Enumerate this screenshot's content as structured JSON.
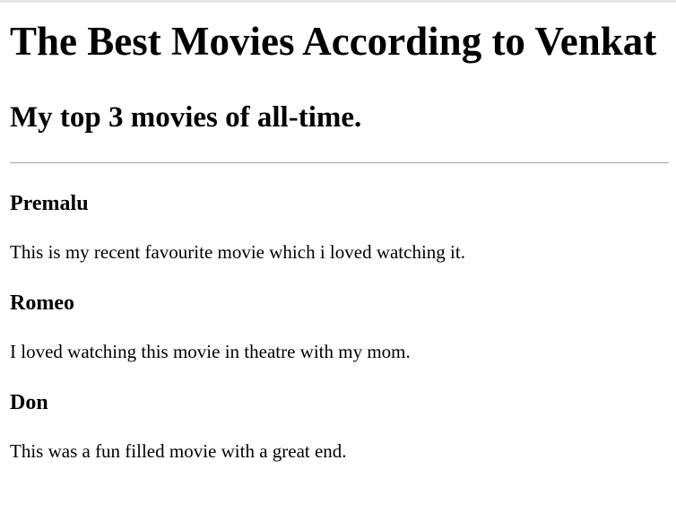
{
  "page": {
    "title": "The Best Movies According to Venkat",
    "subtitle": "My top 3 movies of all-time."
  },
  "movies": [
    {
      "name": "Premalu",
      "description": "This is my recent favourite movie which i loved watching it."
    },
    {
      "name": "Romeo",
      "description": "I loved watching this movie in theatre with my mom."
    },
    {
      "name": "Don",
      "description": "This was a fun filled movie with a great end."
    }
  ]
}
